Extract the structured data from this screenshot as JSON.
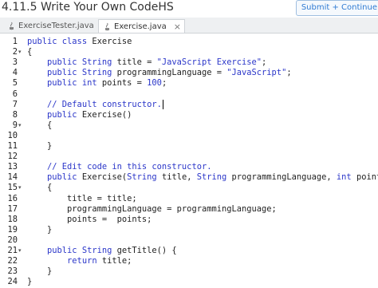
{
  "header": {
    "title": "4.11.5 Write Your Own CodeHS",
    "submit_label": "Submit + Continue"
  },
  "tabs": [
    {
      "label": "ExerciseTester.java",
      "close": "×"
    },
    {
      "label": "Exercise.java",
      "close": "×"
    }
  ],
  "editor": {
    "lines": [
      {
        "n": "1",
        "fold": "",
        "parts": [
          [
            "kw",
            "public class "
          ],
          [
            "plain",
            "Exercise"
          ]
        ]
      },
      {
        "n": "2",
        "fold": "▾",
        "parts": [
          [
            "plain",
            "{"
          ]
        ]
      },
      {
        "n": "3",
        "fold": "",
        "parts": [
          [
            "kw",
            "    public String "
          ],
          [
            "plain",
            "title = "
          ],
          [
            "str",
            "\"JavaScript Exercise\""
          ],
          [
            "plain",
            ";"
          ]
        ]
      },
      {
        "n": "4",
        "fold": "",
        "parts": [
          [
            "kw",
            "    public String "
          ],
          [
            "plain",
            "programmingLanguage = "
          ],
          [
            "str",
            "\"JavaScript\""
          ],
          [
            "plain",
            ";"
          ]
        ]
      },
      {
        "n": "5",
        "fold": "",
        "parts": [
          [
            "kw",
            "    public int "
          ],
          [
            "plain",
            "points = "
          ],
          [
            "num",
            "100"
          ],
          [
            "plain",
            ";"
          ]
        ]
      },
      {
        "n": "6",
        "fold": "",
        "parts": [
          [
            "plain",
            ""
          ]
        ]
      },
      {
        "n": "7",
        "fold": "",
        "parts": [
          [
            "cm",
            "    // Default constructor."
          ]
        ]
      },
      {
        "n": "8",
        "fold": "",
        "parts": [
          [
            "kw",
            "    public "
          ],
          [
            "plain",
            "Exercise()"
          ]
        ]
      },
      {
        "n": "9",
        "fold": "▾",
        "parts": [
          [
            "plain",
            "    {"
          ]
        ]
      },
      {
        "n": "10",
        "fold": "",
        "parts": [
          [
            "plain",
            ""
          ]
        ]
      },
      {
        "n": "11",
        "fold": "",
        "parts": [
          [
            "plain",
            "    }"
          ]
        ]
      },
      {
        "n": "12",
        "fold": "",
        "parts": [
          [
            "plain",
            ""
          ]
        ]
      },
      {
        "n": "13",
        "fold": "",
        "parts": [
          [
            "cm",
            "    // Edit code in this constructor."
          ]
        ]
      },
      {
        "n": "14",
        "fold": "",
        "parts": [
          [
            "kw",
            "    public "
          ],
          [
            "plain",
            "Exercise("
          ],
          [
            "kw",
            "String "
          ],
          [
            "plain",
            "title, "
          ],
          [
            "kw",
            "String "
          ],
          [
            "plain",
            "programmingLanguage, "
          ],
          [
            "kw",
            "int "
          ],
          [
            "plain",
            "points)"
          ]
        ]
      },
      {
        "n": "15",
        "fold": "▾",
        "parts": [
          [
            "plain",
            "    {"
          ]
        ]
      },
      {
        "n": "16",
        "fold": "",
        "parts": [
          [
            "plain",
            "        title = title;"
          ]
        ]
      },
      {
        "n": "17",
        "fold": "",
        "parts": [
          [
            "plain",
            "        programmingLanguage = programmingLanguage;"
          ]
        ]
      },
      {
        "n": "18",
        "fold": "",
        "parts": [
          [
            "plain",
            "        points =  points;"
          ]
        ]
      },
      {
        "n": "19",
        "fold": "",
        "parts": [
          [
            "plain",
            "    }"
          ]
        ]
      },
      {
        "n": "20",
        "fold": "",
        "parts": [
          [
            "plain",
            ""
          ]
        ]
      },
      {
        "n": "21",
        "fold": "▾",
        "parts": [
          [
            "kw",
            "    public String "
          ],
          [
            "plain",
            "getTitle() {"
          ]
        ]
      },
      {
        "n": "22",
        "fold": "",
        "parts": [
          [
            "kw",
            "        return "
          ],
          [
            "plain",
            "title;"
          ]
        ]
      },
      {
        "n": "23",
        "fold": "",
        "parts": [
          [
            "plain",
            "    }"
          ]
        ]
      },
      {
        "n": "24",
        "fold": "",
        "parts": [
          [
            "plain",
            "}"
          ]
        ]
      }
    ],
    "cursor_line": "7"
  },
  "colors": {
    "keyword": "#2b36c9",
    "text": "#222222",
    "accent": "#2f7bd3"
  },
  "icons": {
    "file": "java-file-icon",
    "close": "close-icon"
  }
}
